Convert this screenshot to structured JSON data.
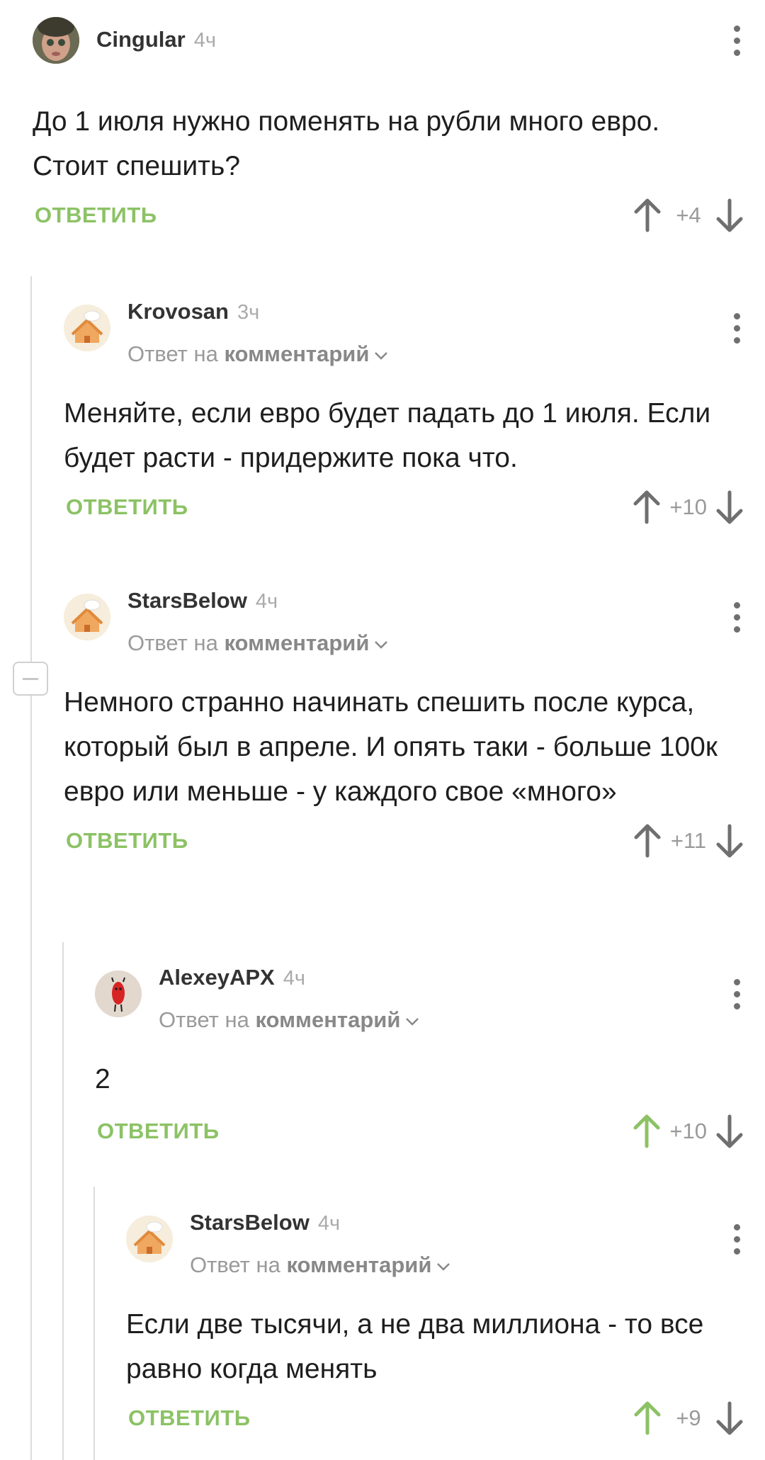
{
  "reply_label": "ОТВЕТИТЬ",
  "reply_prefix": "Ответ на",
  "reply_target": "комментарий",
  "colors": {
    "accent": "#8cc265",
    "upvote_active": "#8cc265",
    "muted": "#9a9a9a"
  },
  "comments": [
    {
      "author": "Cingular",
      "time": "4ч",
      "text": "До 1 июля нужно поменять на рубли много евро. Стоит спешить?",
      "score": "+4",
      "upvoted": false,
      "avatar": "photo-avatar"
    },
    {
      "author": "Krovosan",
      "time": "3ч",
      "text": "Меняйте, если евро будет падать до 1 июля. Если будет расти - придержите пока что.",
      "score": "+10",
      "upvoted": false,
      "avatar": "house-avatar"
    },
    {
      "author": "StarsBelow",
      "time": "4ч",
      "text": "Немного странно начинать спешить после курса, который был в апреле. И опять таки - больше 100к евро или меньше - у каждого свое «много»",
      "score": "+11",
      "upvoted": false,
      "avatar": "house-avatar"
    },
    {
      "author": "AlexeyAPX",
      "time": "4ч",
      "text": "2",
      "score": "+10",
      "upvoted": true,
      "avatar": "red-character-avatar"
    },
    {
      "author": "StarsBelow",
      "time": "4ч",
      "text": "Если две тысячи, а не два миллиона - то все равно когда менять",
      "score": "+9",
      "upvoted": true,
      "avatar": "house-avatar"
    }
  ]
}
